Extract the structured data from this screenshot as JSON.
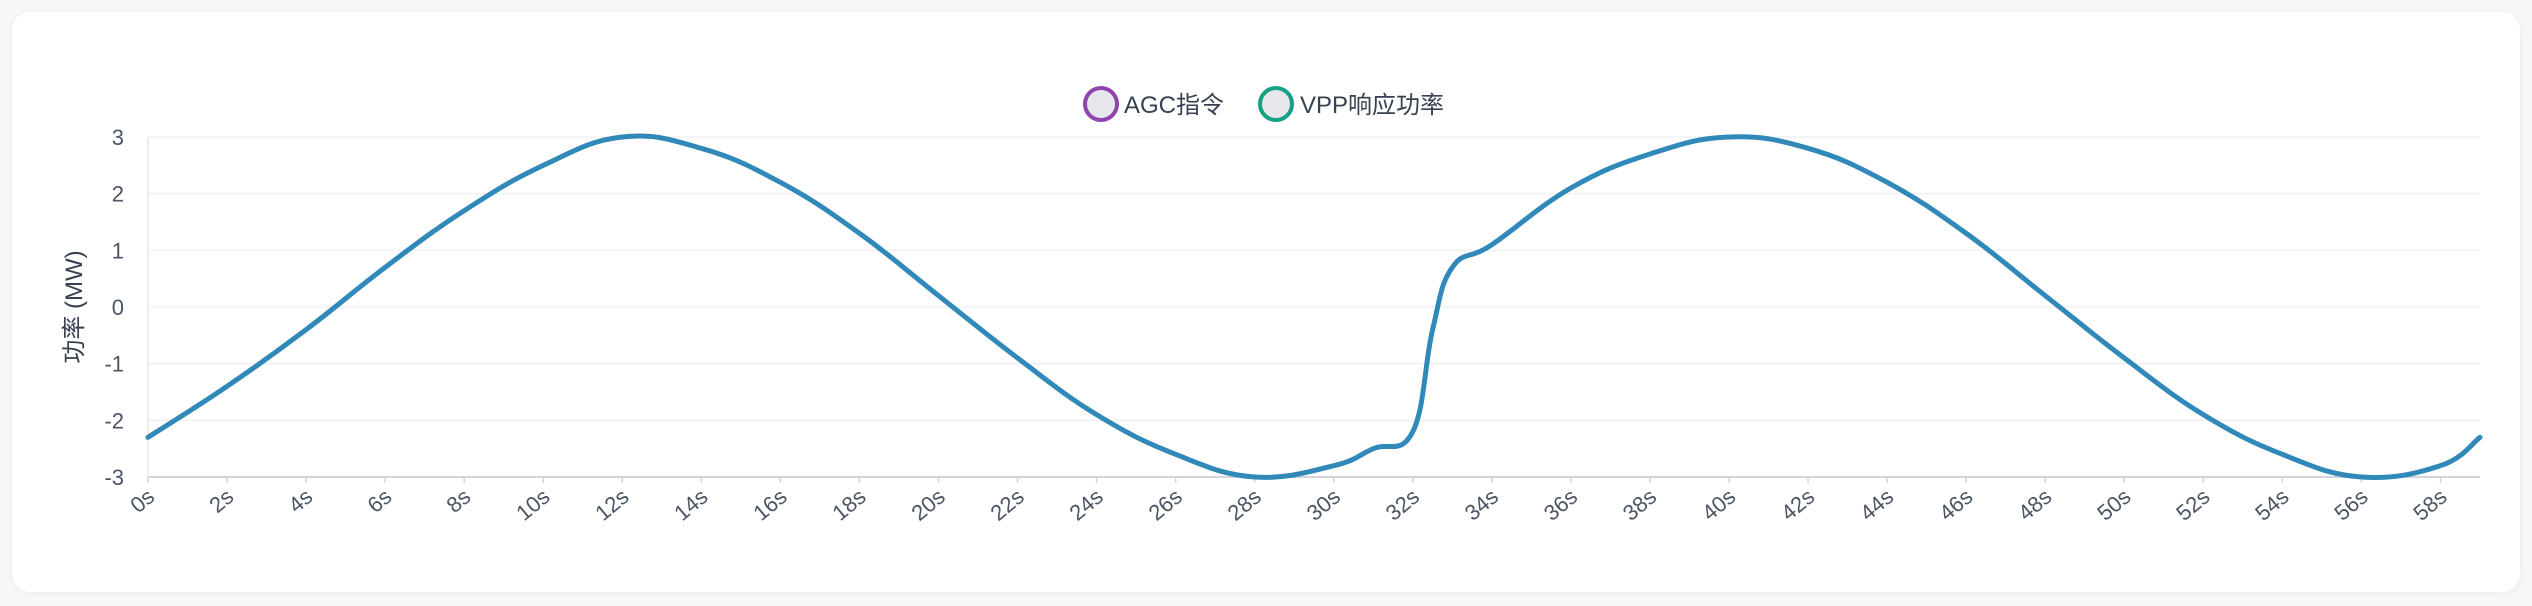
{
  "chart_data": {
    "type": "line",
    "ylabel": "功率 (MW)",
    "ylim": [
      -3,
      3
    ],
    "yticks": [
      "3",
      "2",
      "1",
      "0",
      "-1",
      "-2",
      "-3"
    ],
    "categories": [
      "0s",
      "2s",
      "4s",
      "6s",
      "8s",
      "10s",
      "12s",
      "14s",
      "16s",
      "18s",
      "20s",
      "22s",
      "24s",
      "26s",
      "28s",
      "30s",
      "32s",
      "34s",
      "36s",
      "38s",
      "40s",
      "42s",
      "44s",
      "46s",
      "48s",
      "50s",
      "52s",
      "54s",
      "56s",
      "58s"
    ],
    "legend_position": "top-center",
    "grid": true,
    "series": [
      {
        "name": "AGC指令",
        "color": "#8e44ad",
        "x": [
          0,
          2,
          4,
          6,
          8,
          10,
          12,
          14,
          16,
          18,
          20,
          22,
          24,
          26,
          28,
          30,
          31,
          32,
          32.5,
          33,
          34,
          36,
          38,
          40,
          42,
          44,
          46,
          48,
          50,
          52,
          54,
          56,
          58,
          59
        ],
        "values": [
          -2.3,
          -1.4,
          -0.4,
          0.7,
          1.7,
          2.5,
          3.0,
          2.8,
          2.2,
          1.3,
          0.2,
          -0.9,
          -1.9,
          -2.6,
          -3.0,
          -2.8,
          -2.5,
          -2.2,
          -0.4,
          0.7,
          1.1,
          2.1,
          2.7,
          3.0,
          2.8,
          2.2,
          1.3,
          0.2,
          -0.9,
          -1.9,
          -2.6,
          -3.0,
          -2.8,
          -2.3
        ]
      },
      {
        "name": "VPP响应功率",
        "color": "#16a085",
        "x": [
          0,
          2,
          4,
          6,
          8,
          10,
          12,
          14,
          16,
          18,
          20,
          22,
          24,
          26,
          28,
          30,
          31,
          32,
          32.5,
          33,
          34,
          36,
          38,
          40,
          42,
          44,
          46,
          48,
          50,
          52,
          54,
          56,
          58,
          59
        ],
        "values": [
          -2.3,
          -1.4,
          -0.4,
          0.7,
          1.7,
          2.5,
          3.0,
          2.8,
          2.2,
          1.3,
          0.2,
          -0.9,
          -1.9,
          -2.6,
          -3.0,
          -2.8,
          -2.5,
          -2.2,
          -0.4,
          0.7,
          1.1,
          2.1,
          2.7,
          3.0,
          2.8,
          2.2,
          1.3,
          0.2,
          -0.9,
          -1.9,
          -2.6,
          -3.0,
          -2.8,
          -2.3
        ]
      }
    ],
    "line_color": "#3189b8"
  }
}
